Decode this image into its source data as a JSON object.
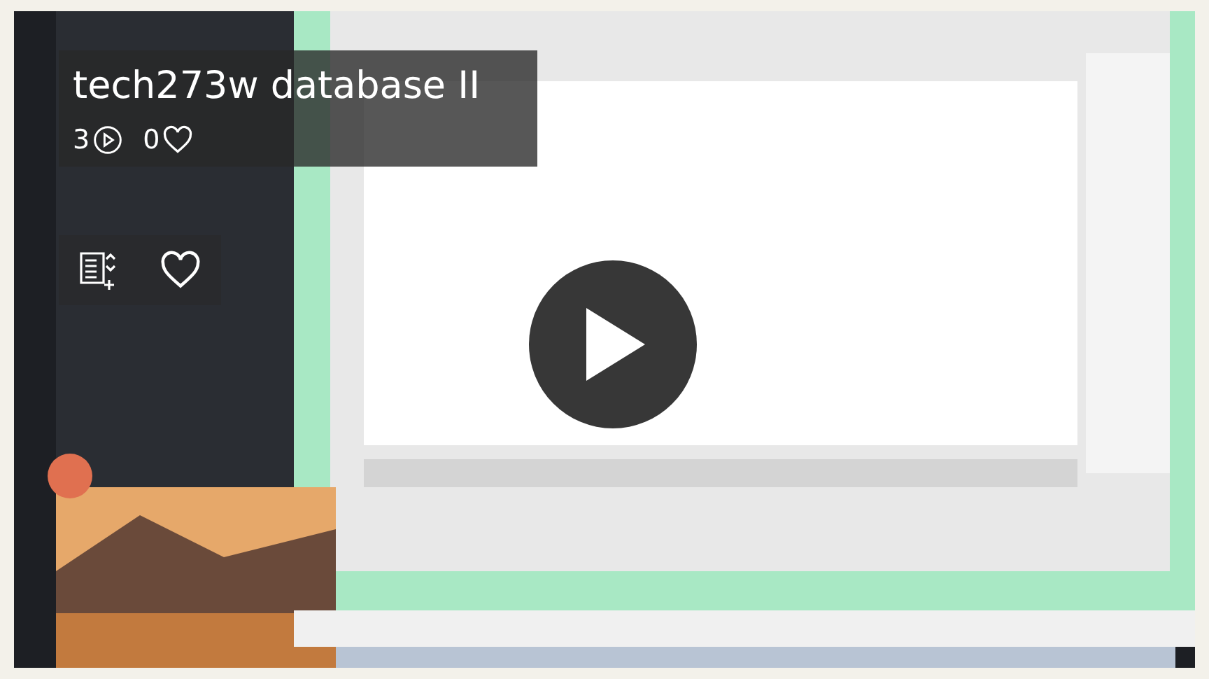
{
  "video": {
    "kind": "picture",
    "title": "tech273w database II",
    "plays": "3",
    "likes": "0",
    "liked": false
  }
}
